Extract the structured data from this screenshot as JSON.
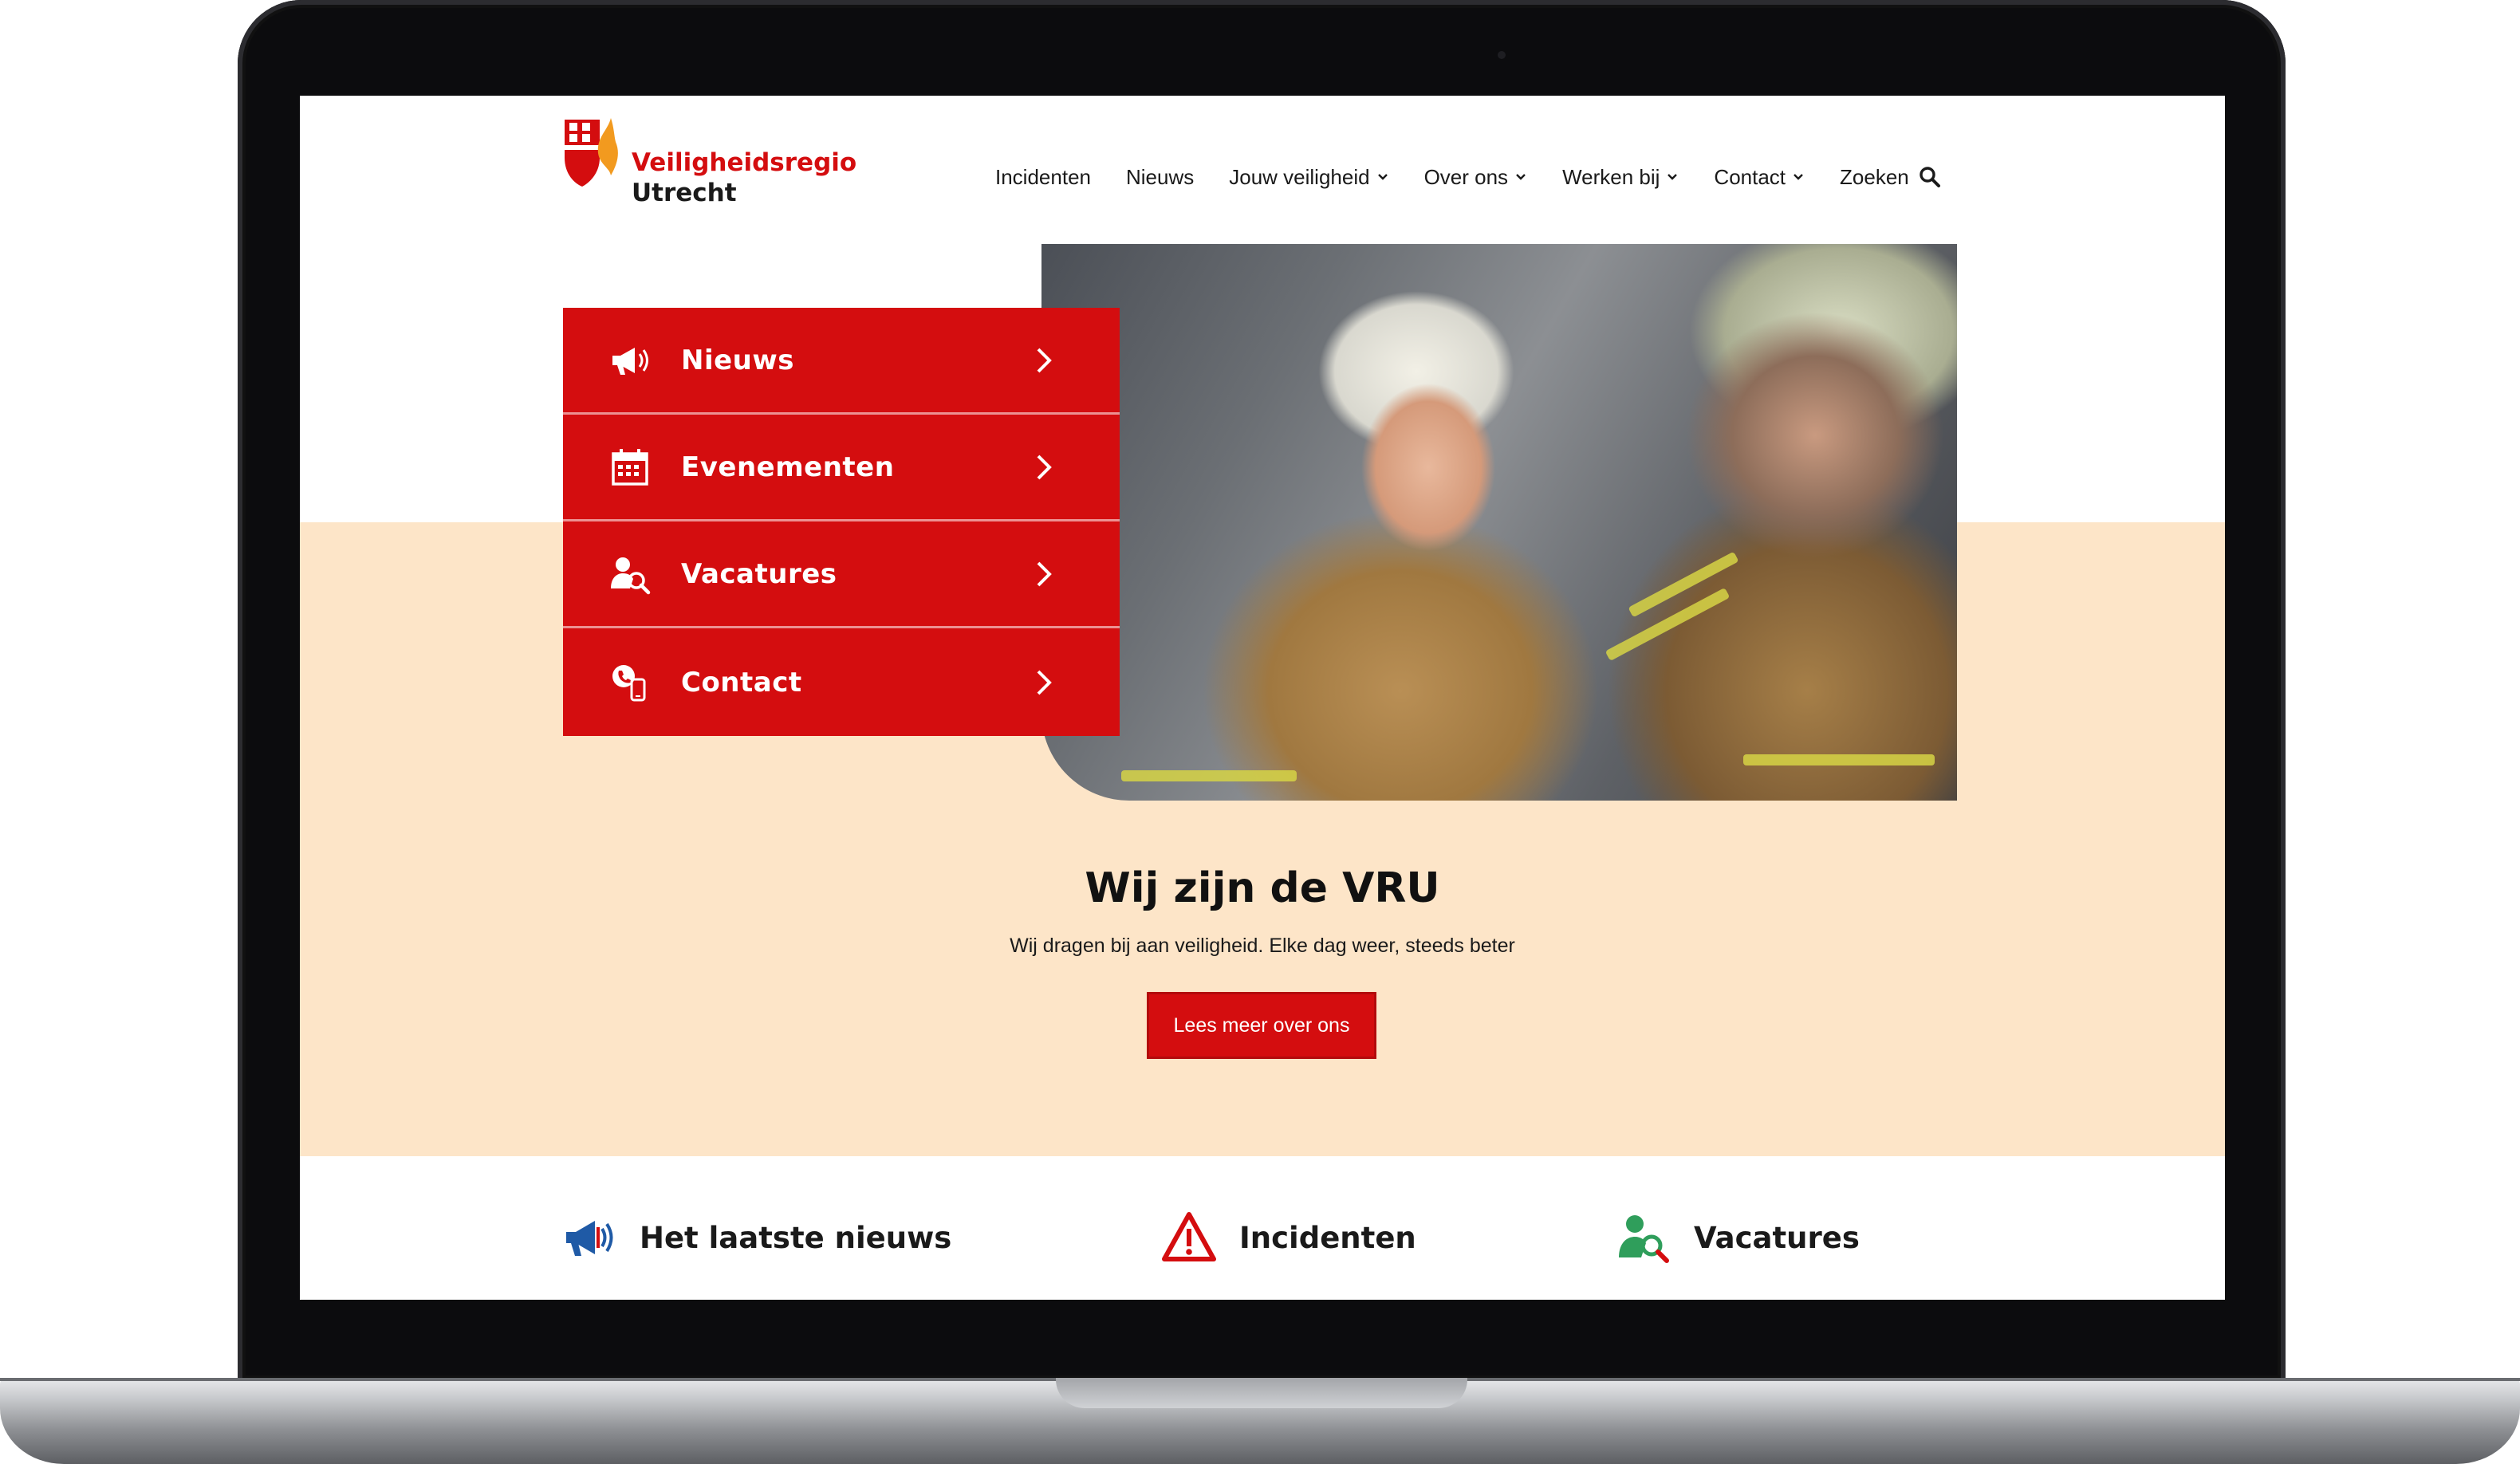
{
  "logo": {
    "line1": "Veiligheidsregio",
    "line2": "Utrecht"
  },
  "nav": {
    "items": [
      {
        "label": "Incidenten",
        "dropdown": false
      },
      {
        "label": "Nieuws",
        "dropdown": false
      },
      {
        "label": "Jouw veiligheid",
        "dropdown": true
      },
      {
        "label": "Over ons",
        "dropdown": true
      },
      {
        "label": "Werken bij",
        "dropdown": true
      },
      {
        "label": "Contact",
        "dropdown": true
      }
    ],
    "search_label": "Zoeken"
  },
  "quick_menu": {
    "items": [
      {
        "label": "Nieuws",
        "icon": "megaphone-icon"
      },
      {
        "label": "Evenementen",
        "icon": "calendar-icon"
      },
      {
        "label": "Vacatures",
        "icon": "person-search-icon"
      },
      {
        "label": "Contact",
        "icon": "phone-contact-icon"
      }
    ]
  },
  "intro": {
    "title": "Wij zijn de VRU",
    "subtitle": "Wij dragen bij aan veiligheid. Elke dag weer, steeds beter",
    "button_label": "Lees meer over ons"
  },
  "bottom_cards": [
    {
      "label": "Het laatste nieuws",
      "icon": "megaphone-icon"
    },
    {
      "label": "Incidenten",
      "icon": "warning-icon"
    },
    {
      "label": "Vacatures",
      "icon": "person-search-icon"
    }
  ],
  "colors": {
    "brand_red": "#d40d0f",
    "beige": "#fde5c8",
    "icon_blue": "#1f5aa6",
    "icon_green": "#2f9e5b"
  }
}
